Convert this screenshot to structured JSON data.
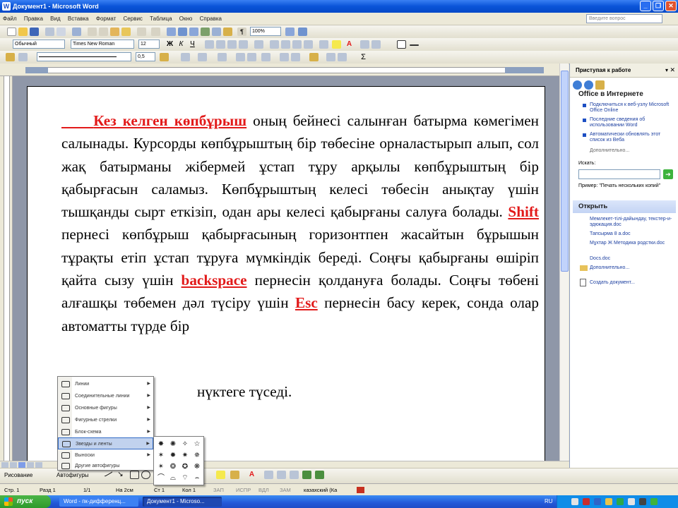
{
  "window": {
    "title": "Документ1 - Microsoft Word",
    "app_icon": "W"
  },
  "menu": {
    "items": [
      "Файл",
      "Правка",
      "Вид",
      "Вставка",
      "Формат",
      "Сервис",
      "Таблица",
      "Окно",
      "Справка"
    ],
    "help_placeholder": "Введите вопрос"
  },
  "toolbar": {
    "zoom": "100%",
    "style": "Обычный",
    "font": "Times New Roman",
    "size": "12",
    "line_size": "0,5"
  },
  "document": {
    "red1": "Кез келген көпбұрыш",
    "t1": " оның бейнесі салынған батырма көмегімен салынады. Курсорды көпбұрыштың бір төбесіне орналастырып алып, сол жақ батырманы жібермей ұстап тұру арқылы көпбұрыштың бір қабырғасын саламыз. Көпбұрыштың келесі төбесін анықтау үшін тышқанды сырт еткізіп, одан ары келесі қабырғаны салуға болады. ",
    "red2": "Shift ",
    "t2": " пернесі көпбұрыш қабырғасының горизонтпен жасайтын бұрышын тұрақты етіп ұстап тұруға мүмкіндік береді. Соңғы қабырғаны өшіріп қайта сызу үшін ",
    "red3": "backspace",
    "t3": " пернесін қолдануға болады. Соңғы төбені алғашқы төбемен дәл түсіру үшін ",
    "red4": "Esc",
    "t4": " пернесін басу керек, сонда олар автоматты түрде бір",
    "line2": "нүктеге түседі."
  },
  "taskpane": {
    "title": "Приступая к работе",
    "office_online": "Office в Интернете",
    "links": [
      "Подключиться к веб-узлу Microsoft Office Online",
      "Последние сведения об использовании Word",
      "Автоматически обновлять этот список из Веба",
      "Дополнительно..."
    ],
    "search_label": "Искать:",
    "search_example": "Пример: \"Печать нескольких копий\"",
    "open_title": "Открыть",
    "files": [
      "Мемлекет-тілі-дайындау, текстер-и-эдюкация.doc",
      "Тапсырма 8 а.doc",
      "Мұхтар Ж Методика родстки.doc",
      "Docs.doc"
    ],
    "more": "Дополнительно...",
    "create": "Создать документ..."
  },
  "drawing": {
    "draw_label": "Рисование",
    "autoshapes_label": "Автофигуры"
  },
  "popup": {
    "items": [
      "Линии",
      "Соединительные линии",
      "Основные фигуры",
      "Фигурные стрелки",
      "Блок-схема",
      "Звезды и ленты",
      "Выноски",
      "Другие автофигуры"
    ],
    "selected_index": 5
  },
  "submenu": {
    "glyphs": [
      "✸",
      "✺",
      "✧",
      "☆",
      "✶",
      "✹",
      "✷",
      "✵",
      "✴",
      "❂",
      "✪",
      "❋",
      "⌒",
      "⌓",
      "⌔",
      "⌢"
    ]
  },
  "status": {
    "page": "Стр. 1",
    "section": "Разд 1",
    "pages": "1/1",
    "pos": "На 2см",
    "line": "Ст 1",
    "col": "Кол 1",
    "flags": [
      "ЗАП",
      "ИСПР",
      "ВДЛ",
      "ЗАМ"
    ],
    "lang": "казахский (Ка"
  },
  "taskbar": {
    "start": "пуск",
    "items": [
      "Word - пк-дифференц...",
      "Документ1 - Microso..."
    ],
    "lang": "RU",
    "time": ""
  },
  "colors": {
    "accent_red": "#e21a1a",
    "title_blue": "#0a54d8",
    "taskbar_blue": "#2358d8"
  }
}
